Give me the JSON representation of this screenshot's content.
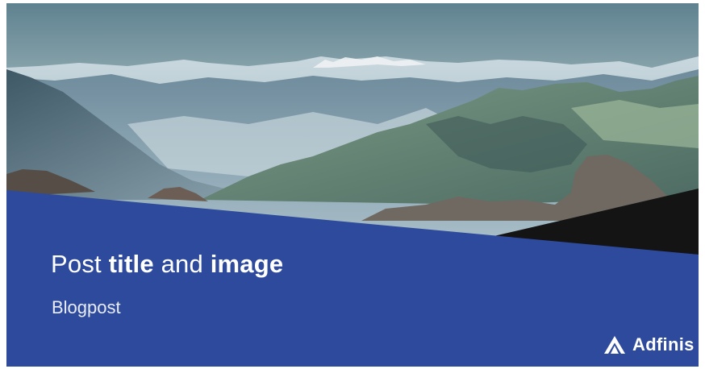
{
  "header": {
    "title_parts": {
      "part1": "Post ",
      "part2": "title",
      "part3": " and ",
      "part4": "image"
    },
    "subtitle": "Blogpost"
  },
  "brand": {
    "name": "Adfinis",
    "logo_icon": "adfinis-logo-icon"
  },
  "colors": {
    "panel": "#2e4a9c",
    "dark_triangle": "#141414",
    "text": "#ffffff"
  }
}
